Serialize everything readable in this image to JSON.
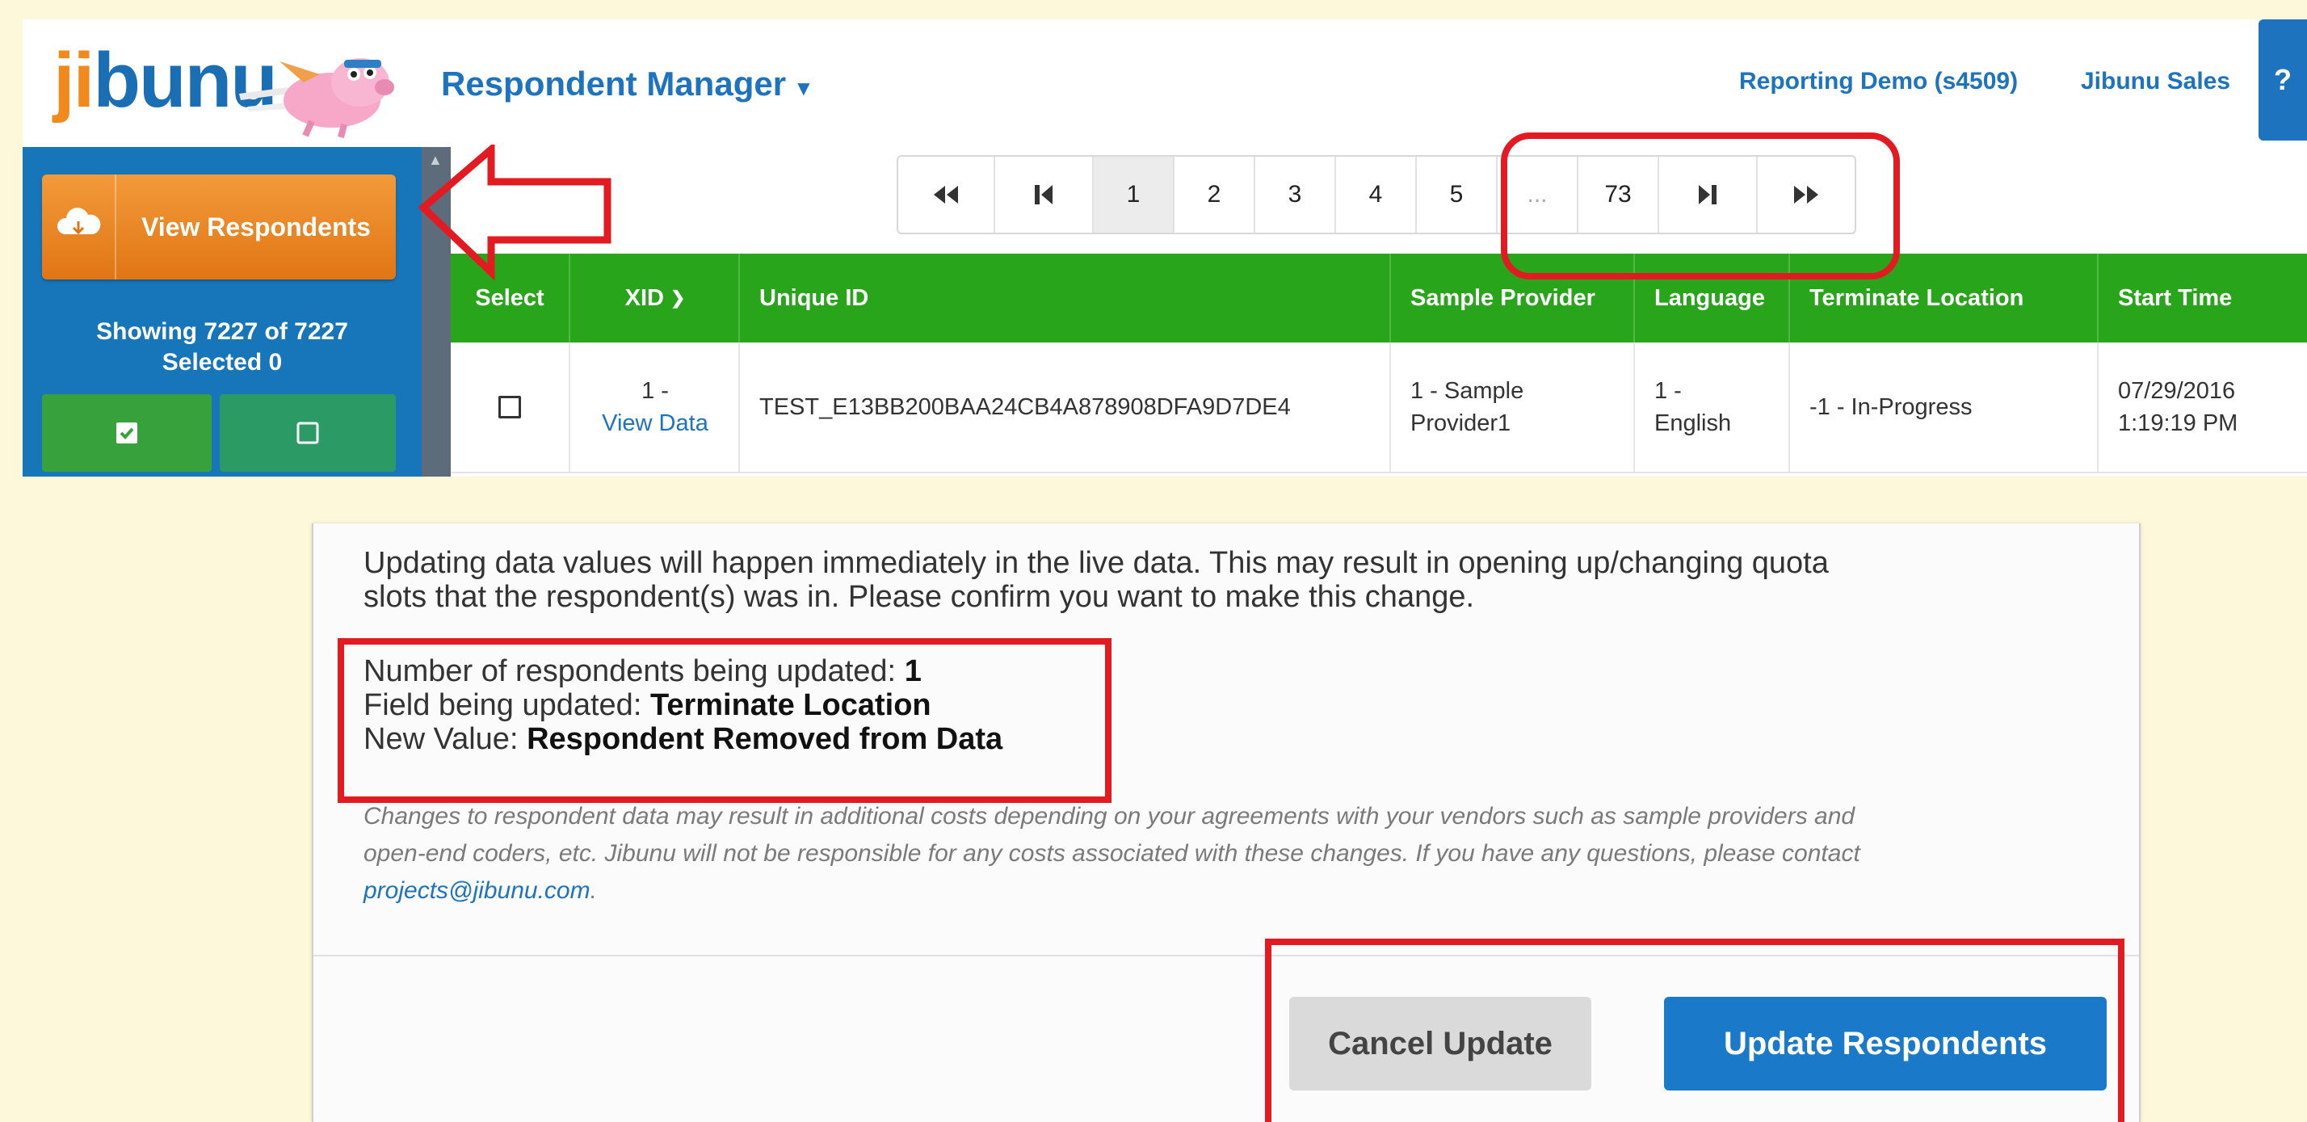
{
  "header": {
    "logo_text_ji": "ji",
    "logo_text_rest": "bunu",
    "app_title": "Respondent Manager",
    "account_link": "Reporting Demo (s4509)",
    "sales_link": "Jibunu Sales",
    "help_label": "?"
  },
  "sidebar": {
    "view_button_label": "View Respondents",
    "showing_text": "Showing 7227 of 7227",
    "selected_text": "Selected 0"
  },
  "pager": {
    "pages": [
      "1",
      "2",
      "3",
      "4",
      "5",
      "...",
      "73"
    ],
    "active_page": "1"
  },
  "grid": {
    "columns": [
      "Select",
      "XID",
      "Unique ID",
      "Sample Provider",
      "Language",
      "Terminate Location",
      "Start Time"
    ],
    "row": {
      "xid": "1 -",
      "xid_link": "View Data",
      "unique_id": "TEST_E13BB200BAA24CB4A878908DFA9D7DE4",
      "sample_provider_line1": "1 - Sample",
      "sample_provider_line2": "Provider1",
      "language_line1": "1 -",
      "language_line2": "English",
      "terminate_location": "-1 - In-Progress",
      "start_date": "07/29/2016",
      "start_time": "1:19:19 PM"
    }
  },
  "dialog": {
    "warning_line1": "Updating data values will happen immediately in the live data. This may result in opening up/changing quota",
    "warning_line2": "slots that the respondent(s) was in. Please confirm you want to make this change.",
    "count_label": "Number of respondents being updated: ",
    "count_value": "1",
    "field_label": "Field being updated: ",
    "field_value": "Terminate Location",
    "newval_label": "New Value: ",
    "newval_value": "Respondent Removed from Data",
    "disclaimer_line1": "Changes to respondent data may result in additional costs depending on your agreements with your vendors such as sample providers and",
    "disclaimer_line2": "open-end coders, etc. Jibunu will not be responsible for any costs associated with these changes. If you have any questions, please contact",
    "disclaimer_email": "projects@jibunu.com",
    "disclaimer_end": ".",
    "cancel_label": "Cancel Update",
    "update_label": "Update Respondents"
  },
  "colors": {
    "brand_blue": "#1e73be",
    "grid_header_green": "#29a51b",
    "orange_button": "#e17514",
    "annotation_red": "#e21b23"
  }
}
